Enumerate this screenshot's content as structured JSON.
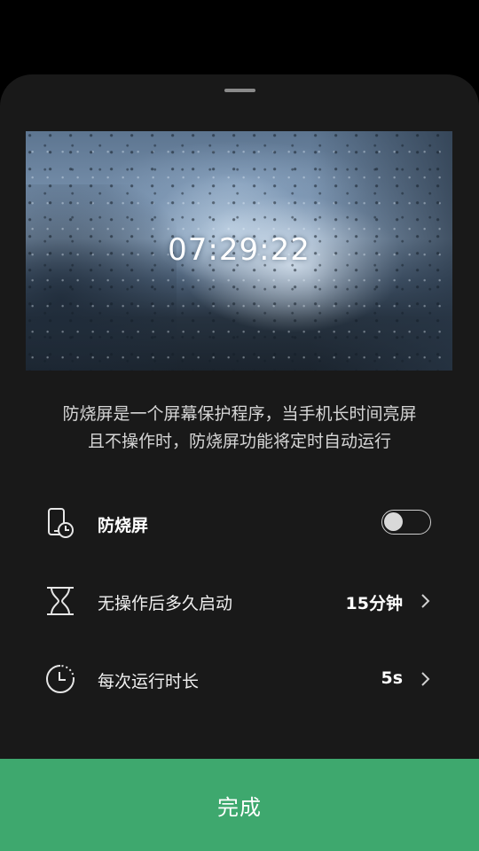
{
  "preview": {
    "clock_text": "07:29:22"
  },
  "description": {
    "line1": "防烧屏是一个屏幕保护程序，当手机长时间亮屏",
    "line2": "且不操作时，防烧屏功能将定时自动运行"
  },
  "settings": {
    "burn_in": {
      "icon": "phone-clock-icon",
      "label": "防烧屏",
      "enabled": false
    },
    "idle_start": {
      "icon": "hourglass-icon",
      "label": "无操作后多久启动",
      "value": "15分钟"
    },
    "run_duration": {
      "icon": "clock-icon",
      "label": "每次运行时长",
      "value": "5s"
    }
  },
  "footer": {
    "done_label": "完成"
  },
  "colors": {
    "sheet_bg": "#191919",
    "accent_green": "#3ea86e"
  }
}
